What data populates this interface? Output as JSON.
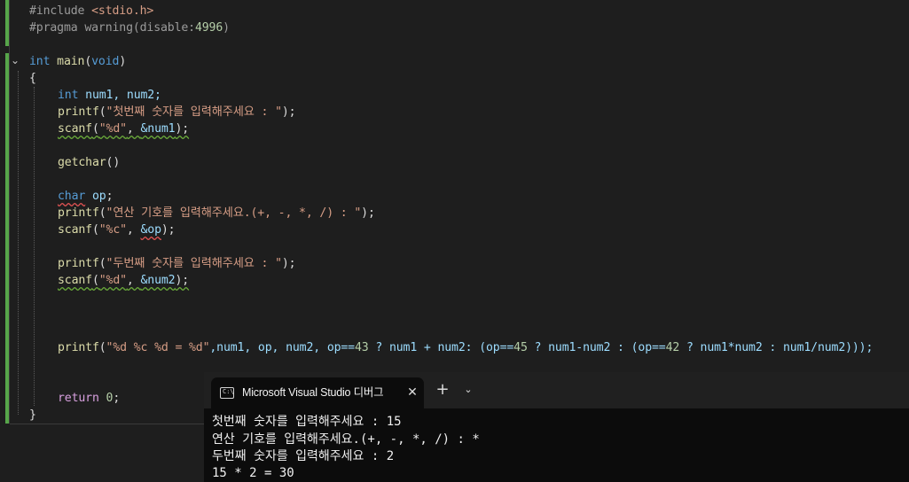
{
  "editor": {
    "fold_glyph": "⌄",
    "lines": {
      "l1": [
        "#include ",
        "<stdio.h>"
      ],
      "l2": [
        "#pragma ",
        "warning(disable:",
        "4996",
        ")"
      ],
      "l4": [
        "int",
        " ",
        "main",
        "(",
        "void",
        ")"
      ],
      "l5": [
        "{"
      ],
      "l6": [
        "int",
        " num1, num2;"
      ],
      "l7": [
        "printf",
        "(",
        "\"첫번째 숫자를 입력해주세요 : \"",
        ");"
      ],
      "l8": [
        "scanf",
        "(",
        "\"%d\"",
        ", ",
        "&num1",
        ");"
      ],
      "l10": [
        "getchar",
        "()"
      ],
      "l12": [
        "char",
        " ",
        "op",
        ";"
      ],
      "l13": [
        "printf",
        "(",
        "\"연산 기호를 입력해주세요.(+, -, *, /) : \"",
        ");"
      ],
      "l14": [
        "scanf",
        "(",
        "\"%c\"",
        ", ",
        "&op",
        ");"
      ],
      "l16": [
        "printf",
        "(",
        "\"두번째 숫자를 입력해주세요 : \"",
        ");"
      ],
      "l17": [
        "scanf",
        "(",
        "\"%d\"",
        ", ",
        "&num2",
        ");"
      ],
      "l21": [
        "printf",
        "(",
        "\"%d %c %d = %d\"",
        ",num1, op, num2, op==",
        "43",
        " ? num1 + num2: (op==",
        "45",
        " ? num1-num2 : (op==",
        "42",
        " ? num1*num2 : num1/num2)));"
      ],
      "l24": [
        "return",
        " ",
        "0",
        ";"
      ],
      "l25": [
        "}"
      ]
    }
  },
  "terminal": {
    "tab_title": "Microsoft Visual Studio 디버그",
    "icon_label": "C:\\",
    "close_glyph": "✕",
    "new_tab_glyph": "+",
    "dropdown_glyph": "⌄",
    "output": [
      "첫번째 숫자를 입력해주세요 : 15",
      "연산 기호를 입력해주세요.(+, -, *, /) : *",
      "두번째 숫자를 입력해주세요 : 2",
      "15 * 2 = 30"
    ]
  }
}
